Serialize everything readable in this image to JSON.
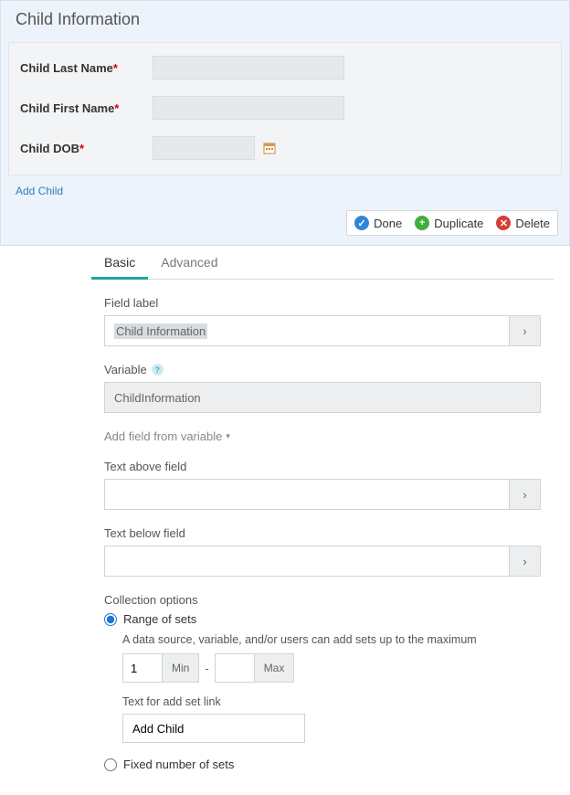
{
  "form": {
    "title": "Child Information",
    "fields": {
      "lastNameLabel": "Child Last Name",
      "firstNameLabel": "Child First Name",
      "dobLabel": "Child DOB",
      "lastNameValue": "",
      "firstNameValue": "",
      "dobValue": ""
    },
    "addLink": "Add Child"
  },
  "actions": {
    "done": "Done",
    "duplicate": "Duplicate",
    "delete": "Delete"
  },
  "tabs": {
    "basic": "Basic",
    "advanced": "Advanced"
  },
  "panel": {
    "fieldLabel": {
      "label": "Field label",
      "value": "Child Information"
    },
    "variable": {
      "label": "Variable",
      "value": "ChildInformation"
    },
    "addFromVar": "Add field from variable",
    "textAbove": {
      "label": "Text above field",
      "value": ""
    },
    "textBelow": {
      "label": "Text below field",
      "value": ""
    },
    "collection": {
      "heading": "Collection options",
      "rangeLabel": "Range of sets",
      "rangeHint": "A data source, variable, and/or users can add sets up to the maximum",
      "min": "1",
      "minLabel": "Min",
      "max": "",
      "maxLabel": "Max",
      "addSetLabel": "Text for add set link",
      "addSetValue": "Add Child",
      "fixedLabel": "Fixed number of sets"
    }
  }
}
